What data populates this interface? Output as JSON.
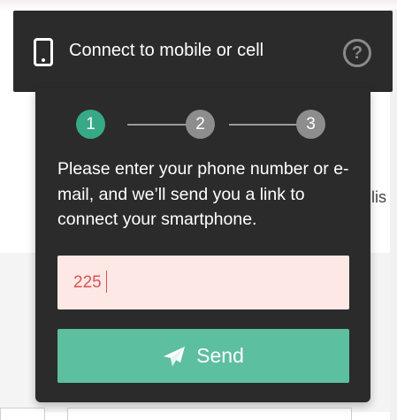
{
  "header": {
    "title": "Connect to mobile or cell",
    "help_symbol": "?",
    "phone_icon": "mobile-phone-icon",
    "help_icon": "question-circle-icon"
  },
  "steps": [
    {
      "label": "1",
      "state": "active"
    },
    {
      "label": "2",
      "state": "pending"
    },
    {
      "label": "3",
      "state": "pending"
    }
  ],
  "panel": {
    "instructions": "Please enter your phone number or e-mail, and we’ll send you a link to connect your smartphone."
  },
  "contact_input": {
    "value": "225"
  },
  "send_button": {
    "label": "Send",
    "icon": "paper-plane-icon"
  },
  "background_page": {
    "partial_text": "glis"
  },
  "colors": {
    "panel_bg": "#2b2b2b",
    "step_active": "#37a986",
    "step_pending": "#8d8d8d",
    "input_bg": "#fde8e6",
    "input_text": "#d9534f",
    "send_button_bg": "#5cbf9f"
  }
}
